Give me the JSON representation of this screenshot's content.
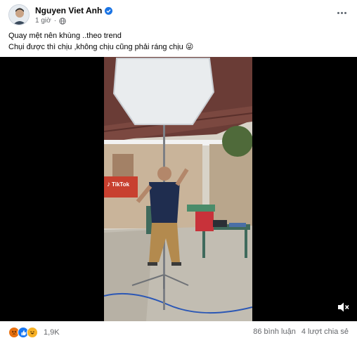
{
  "post": {
    "author": "Nguyen Viet Anh",
    "time": "1 giờ",
    "caption_line1": "Quay mệt nên khùng ..theo trend",
    "caption_line2": "Chụi được thì chịu ,không chịu cũng phải ráng chịu 😜"
  },
  "video": {
    "watermark_brand": "TikTok"
  },
  "footer": {
    "reaction_count": "1,9K",
    "comments": "86 bình luận",
    "shares": "4 lượt chia sẻ",
    "reaction_icons": [
      "angry-icon",
      "like-icon",
      "haha-icon"
    ]
  },
  "colors": {
    "verified": "#1b74e4",
    "like": "#1877f2",
    "angry": "#e9710f",
    "haha": "#f7b125",
    "meta_text": "#65676b"
  }
}
